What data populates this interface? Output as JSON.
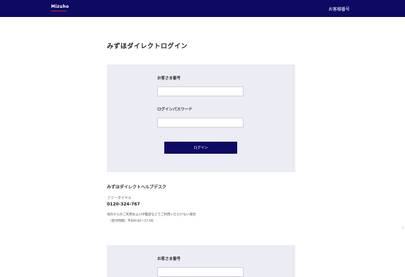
{
  "header": {
    "logo_text": "Mizuho",
    "link_label": "お客様番号"
  },
  "login": {
    "title": "みずほダイレクトログイン",
    "customer_number_label": "お客さま番号",
    "customer_number_value": "",
    "password_label": "ログインパスワード",
    "password_value": "",
    "button_label": "ログイン"
  },
  "help": {
    "title": "みずほダイレクトヘルプデスク",
    "sub": "フリーダイヤル",
    "phone": "0120-324-767",
    "note": "海外からのご利用およびIP電話などでご利用いただけない場合",
    "hours": "（受付時間）平日9:00〜17:00"
  },
  "login2": {
    "customer_number_label": "お客さま番号",
    "customer_number_value": ""
  },
  "scroll": {
    "arrow": "‹"
  },
  "colors": {
    "brand_navy": "#0c0a63",
    "panel_bg": "#ececf4",
    "logo_accent": "#d11a3a"
  }
}
